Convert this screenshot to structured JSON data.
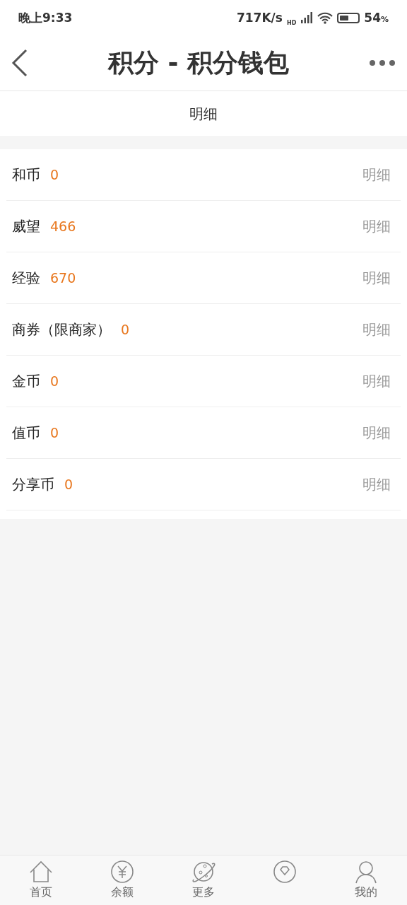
{
  "status_bar": {
    "time": "晚上9:33",
    "speed": "717K/s",
    "network": "HD",
    "battery": "54",
    "battery_unit": "%"
  },
  "header": {
    "title": "积分 - 积分钱包"
  },
  "tab": {
    "label": "明细"
  },
  "rows": [
    {
      "name": "和币",
      "value": "0",
      "action": "明细"
    },
    {
      "name": "威望",
      "value": "466",
      "action": "明细"
    },
    {
      "name": "经验",
      "value": "670",
      "action": "明细"
    },
    {
      "name": "商券（限商家）",
      "value": "0",
      "action": "明细"
    },
    {
      "name": "金币",
      "value": "0",
      "action": "明细"
    },
    {
      "name": "值币",
      "value": "0",
      "action": "明细"
    },
    {
      "name": "分享币",
      "value": "0",
      "action": "明细"
    }
  ],
  "bottom_nav": [
    {
      "kind": "home",
      "label": "首页"
    },
    {
      "kind": "yen",
      "label": "余额"
    },
    {
      "kind": "planet",
      "label": "更多"
    },
    {
      "kind": "gem"
    },
    {
      "kind": "person",
      "label": "我的"
    }
  ]
}
